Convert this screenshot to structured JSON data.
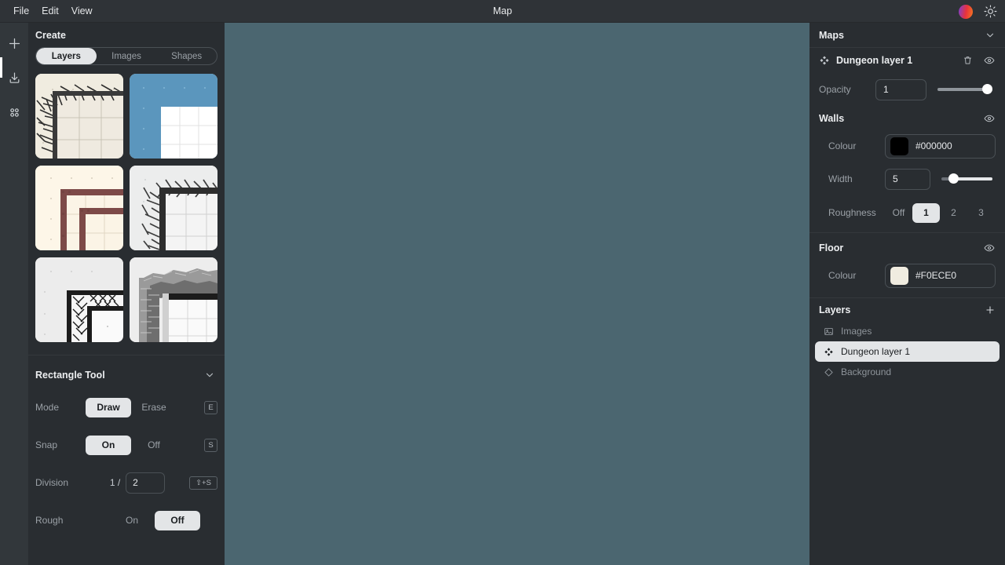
{
  "titlebar": {
    "title": "Map",
    "menus": [
      {
        "label": "File"
      },
      {
        "label": "Edit"
      },
      {
        "label": "View"
      }
    ],
    "avatar_name": "user-avatar",
    "theme_icon": "sun-icon"
  },
  "rail": {
    "items": [
      {
        "name": "add-icon",
        "label": "Add"
      },
      {
        "name": "download-icon",
        "label": "Download"
      },
      {
        "name": "grid-dots-icon",
        "label": "Assets"
      }
    ]
  },
  "create_panel": {
    "title": "Create",
    "tabs": [
      {
        "label": "Layers",
        "active": true
      },
      {
        "label": "Images",
        "active": false
      },
      {
        "label": "Shapes",
        "active": false
      }
    ],
    "thumbnails": [
      {
        "name": "thumb-hatched-walls-cream",
        "selected": false
      },
      {
        "name": "thumb-blue-water",
        "selected": true
      },
      {
        "name": "thumb-red-brick",
        "selected": false
      },
      {
        "name": "thumb-hatched-walls-grey",
        "selected": false
      },
      {
        "name": "thumb-herringbone",
        "selected": false
      },
      {
        "name": "thumb-cobblestone",
        "selected": false
      }
    ]
  },
  "tool_panel": {
    "title": "Rectangle Tool",
    "collapse_icon": "chevron-down-icon",
    "rows": [
      {
        "label": "Mode",
        "type": "pills",
        "options": [
          {
            "label": "Draw",
            "active": true
          },
          {
            "label": "Erase",
            "active": false
          }
        ],
        "shortcut": "E"
      },
      {
        "label": "Snap",
        "type": "pills",
        "options": [
          {
            "label": "On",
            "active": true
          },
          {
            "label": "Off",
            "active": false
          }
        ],
        "shortcut": "S"
      },
      {
        "label": "Division",
        "type": "fraction",
        "prefix": "1 /",
        "value": "2",
        "shortcut": "⇧+S"
      },
      {
        "label": "Rough",
        "type": "pills",
        "options": [
          {
            "label": "On",
            "active": false
          },
          {
            "label": "Off",
            "active": true
          }
        ],
        "shortcut": ""
      }
    ]
  },
  "maps_panel": {
    "title": "Maps",
    "collapse_icon": "chevron-down-icon",
    "selected_layer": {
      "icon": "diamond-cluster-icon",
      "name": "Dungeon layer 1",
      "delete_icon": "trash-icon",
      "visibility_icon": "eye-icon"
    },
    "opacity": {
      "label": "Opacity",
      "value": "1",
      "slider_percent": 100
    },
    "walls": {
      "title": "Walls",
      "visibility_icon": "eye-icon",
      "colour": {
        "label": "Colour",
        "value": "#000000",
        "swatch": "#000000"
      },
      "width": {
        "label": "Width",
        "value": "5",
        "slider_percent": 25
      },
      "roughness": {
        "label": "Roughness",
        "options": [
          {
            "label": "Off",
            "active": false
          },
          {
            "label": "1",
            "active": true
          },
          {
            "label": "2",
            "active": false
          },
          {
            "label": "3",
            "active": false
          }
        ]
      }
    },
    "floor": {
      "title": "Floor",
      "visibility_icon": "eye-icon",
      "colour": {
        "label": "Colour",
        "value": "#F0ECE0",
        "swatch": "#F0ECE0"
      }
    }
  },
  "layers_panel": {
    "title": "Layers",
    "add_icon": "plus-icon",
    "items": [
      {
        "icon": "image-icon",
        "label": "Images",
        "active": false
      },
      {
        "icon": "diamond-cluster-icon",
        "label": "Dungeon layer 1",
        "active": true
      },
      {
        "icon": "diamond-outline-icon",
        "label": "Background",
        "active": false
      }
    ]
  },
  "canvas": {
    "name": "map-canvas",
    "background": "#4B6670"
  }
}
